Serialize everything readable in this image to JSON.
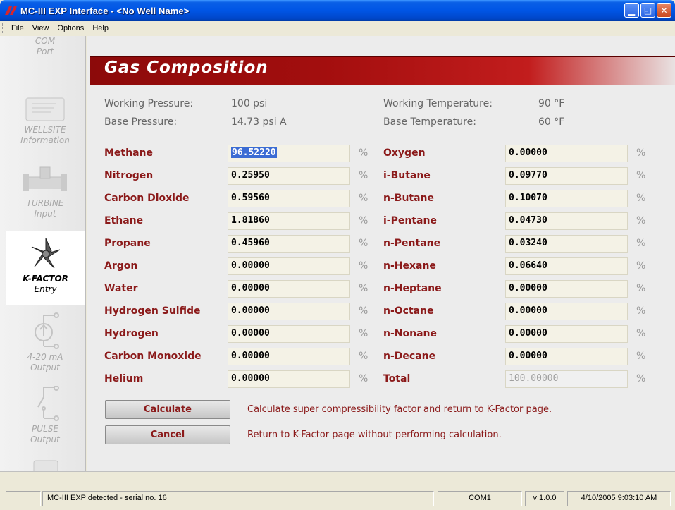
{
  "window": {
    "title": "MC-III EXP Interface - <No Well Name>",
    "controls": {
      "minimize": "▁",
      "maximize": "◱",
      "close": "✕"
    }
  },
  "menu": [
    {
      "label": "File"
    },
    {
      "label": "View"
    },
    {
      "label": "Options"
    },
    {
      "label": "Help"
    }
  ],
  "sidebar": {
    "com_port": {
      "line1": "COM",
      "line2": "Port"
    },
    "wellsite": {
      "line1": "WELLSITE",
      "line2": "Information"
    },
    "turbine": {
      "line1": "TURBINE",
      "line2": "Input"
    },
    "kfactor": {
      "line1": "K-FACTOR",
      "line2": "Entry"
    },
    "ma_output": {
      "line1": "4-20 mA",
      "line2": "Output"
    },
    "pulse_output": {
      "line1": "PULSE",
      "line2": "Output"
    }
  },
  "page": {
    "title": "Gas Composition"
  },
  "conditions": {
    "working_pressure_label": "Working Pressure:",
    "working_pressure_value": "100 psi",
    "base_pressure_label": "Base Pressure:",
    "base_pressure_value": "14.73 psi A",
    "working_temp_label": "Working Temperature:",
    "working_temp_value": "90 °F",
    "base_temp_label": "Base Temperature:",
    "base_temp_value": "60 °F"
  },
  "unit": "%",
  "gases_left": [
    {
      "name": "Methane",
      "value": "96.52220"
    },
    {
      "name": "Nitrogen",
      "value": "0.25950"
    },
    {
      "name": "Carbon Dioxide",
      "value": "0.59560"
    },
    {
      "name": "Ethane",
      "value": "1.81860"
    },
    {
      "name": "Propane",
      "value": "0.45960"
    },
    {
      "name": "Argon",
      "value": "0.00000"
    },
    {
      "name": "Water",
      "value": "0.00000"
    },
    {
      "name": "Hydrogen Sulfide",
      "value": "0.00000"
    },
    {
      "name": "Hydrogen",
      "value": "0.00000"
    },
    {
      "name": "Carbon Monoxide",
      "value": "0.00000"
    },
    {
      "name": "Helium",
      "value": "0.00000"
    }
  ],
  "gases_right": [
    {
      "name": "Oxygen",
      "value": "0.00000"
    },
    {
      "name": "i-Butane",
      "value": "0.09770"
    },
    {
      "name": "n-Butane",
      "value": "0.10070"
    },
    {
      "name": "i-Pentane",
      "value": "0.04730"
    },
    {
      "name": "n-Pentane",
      "value": "0.03240"
    },
    {
      "name": "n-Hexane",
      "value": "0.06640"
    },
    {
      "name": "n-Heptane",
      "value": "0.00000"
    },
    {
      "name": "n-Octane",
      "value": "0.00000"
    },
    {
      "name": "n-Nonane",
      "value": "0.00000"
    },
    {
      "name": "n-Decane",
      "value": "0.00000"
    },
    {
      "name": "Total",
      "value": "100.00000"
    }
  ],
  "buttons": {
    "calculate_label": "Calculate",
    "calculate_desc": "Calculate super compressibility factor and return to K-Factor page.",
    "cancel_label": "Cancel",
    "cancel_desc": "Return to K-Factor page without performing calculation."
  },
  "status": {
    "message": "MC-III EXP detected - serial no. 16",
    "port": "COM1",
    "version": "v 1.0.0",
    "datetime": "4/10/2005 9:03:10 AM"
  }
}
